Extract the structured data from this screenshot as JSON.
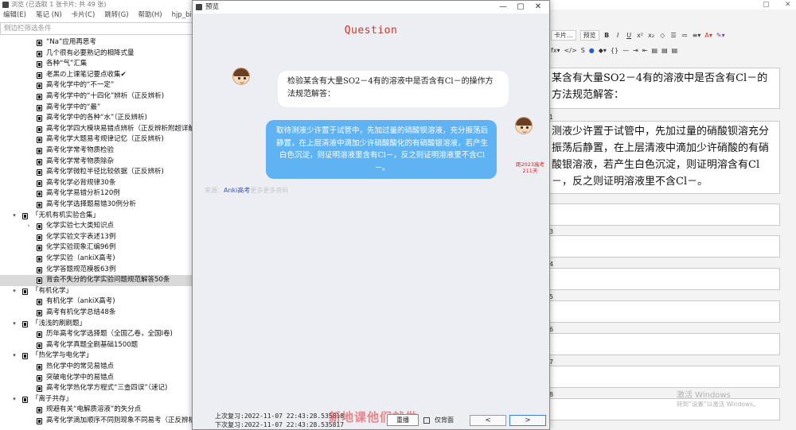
{
  "browser": {
    "title": "浏览 (已选取 1 张卡片; 共 49 张)",
    "menu": [
      "编辑(E)",
      "笔记 (N)",
      "卡片(C)",
      "跳转(G)",
      "帮助(H)",
      "hjp_bilink"
    ],
    "filter_placeholder": "侧边栏筛选条件"
  },
  "sidebar": {
    "rows": [
      {
        "label": "“Na”应用再思考",
        "level": 2,
        "type": "deck"
      },
      {
        "label": "几个很有必要熟记的相降式量",
        "level": 2,
        "type": "deck"
      },
      {
        "label": "各种“气”汇集",
        "level": 2,
        "type": "deck"
      },
      {
        "label": "老黑の上课笔记要点收集✔",
        "level": 2,
        "type": "deck"
      },
      {
        "label": "高考化学中的“不一定”",
        "level": 2,
        "type": "deck"
      },
      {
        "label": "高考化学中的“十四化”辨析（正反辨析)",
        "level": 2,
        "type": "deck"
      },
      {
        "label": "高考化学中的“最”",
        "level": 2,
        "type": "deck"
      },
      {
        "label": "高考化学中的各种“水”（正反辨析)",
        "level": 2,
        "type": "deck"
      },
      {
        "label": "高考化学四大模块易错点辨析（正反辨析附超详解析",
        "level": 2,
        "type": "deck"
      },
      {
        "label": "高考化学大题易考规律记忆（正反辨析)",
        "level": 2,
        "type": "deck"
      },
      {
        "label": "高考化学常考物质检验",
        "level": 2,
        "type": "deck"
      },
      {
        "label": "高考化学常考物质除杂",
        "level": 2,
        "type": "deck"
      },
      {
        "label": "高考化学微粒半径比较依据（正反辨析)",
        "level": 2,
        "type": "deck"
      },
      {
        "label": "高考化学必背规律30条",
        "level": 2,
        "type": "deck"
      },
      {
        "label": "高考化学易错分析120例",
        "level": 2,
        "type": "deck"
      },
      {
        "label": "高考化学选择题易错30例分析",
        "level": 2,
        "type": "deck"
      },
      {
        "label": "「无机有机实验合集」",
        "level": 1,
        "type": "group"
      },
      {
        "label": "化学实验七大类知识点",
        "level": 2,
        "type": "deck",
        "collapsed": true
      },
      {
        "label": "化学实验文字表述13例",
        "level": 2,
        "type": "deck"
      },
      {
        "label": "化学实验现象汇编96例",
        "level": 2,
        "type": "deck"
      },
      {
        "label": "化学实验（ankiX高考)",
        "level": 2,
        "type": "deck"
      },
      {
        "label": "化学答题规范模板63例",
        "level": 2,
        "type": "deck"
      },
      {
        "label": "背会不失分的化学实验问题规范解答50条",
        "level": 2,
        "type": "deck",
        "selected": true
      },
      {
        "label": "「有机化学」",
        "level": 1,
        "type": "group"
      },
      {
        "label": "有机化学（ankiX高考)",
        "level": 2,
        "type": "deck"
      },
      {
        "label": "高考有机化学总结48条",
        "level": 2,
        "type": "deck"
      },
      {
        "label": "「浅浅的刷刷题」",
        "level": 1,
        "type": "group"
      },
      {
        "label": "历年高考化学选择题（全国乙卷，全国I卷)",
        "level": 2,
        "type": "deck"
      },
      {
        "label": "高考化学真题全刷基础1500题",
        "level": 2,
        "type": "deck"
      },
      {
        "label": "「热化学与电化学」",
        "level": 1,
        "type": "group"
      },
      {
        "label": "热化学中的常见易错点",
        "level": 2,
        "type": "deck"
      },
      {
        "label": "突破电化学中的易错点",
        "level": 2,
        "type": "deck"
      },
      {
        "label": "高考化学热化学方程式“三查四误”（速记)",
        "level": 2,
        "type": "deck"
      },
      {
        "label": "「离子共存」",
        "level": 1,
        "type": "group"
      },
      {
        "label": "规避有关“电解质溶液”的失分点",
        "level": 2,
        "type": "deck"
      },
      {
        "label": "高考化学滴加顺序不同则现象不同易考（正反辨析)可复习",
        "level": 2,
        "type": "deck"
      }
    ]
  },
  "editor": {
    "toolbar_card": "卡片...",
    "toolbar_preview": "预览",
    "fields": [
      {
        "num": "",
        "text": "某含有大量SO2－4有的溶液中是否含有Cl－的方法规范解答："
      },
      {
        "num": "1",
        "text": "测液少许置于试管中，先加过量的硝酸钡溶充分振荡后静置，在上层清液中滴加少许硝酸的有硝酸银溶液，若产生白色沉淀，则证明溶含有Cl－，反之则证明溶液里不含Cl－。"
      },
      {
        "num": "",
        "text": ""
      },
      {
        "num": "3",
        "text": ""
      },
      {
        "num": "4",
        "text": ""
      },
      {
        "num": "5",
        "text": ""
      },
      {
        "num": "6",
        "text": ""
      },
      {
        "num": "7",
        "text": ""
      },
      {
        "num": "8",
        "text": ""
      }
    ],
    "watermark_line1": "激活 Windows",
    "watermark_line2": "转到“设置”以激活 Windows。"
  },
  "review": {
    "last": "上次复习:2022-11-07 22:43:28.535818",
    "next": "下次复习:2022-11-07 22:43:28.535817",
    "overlay": "新地课他们就做",
    "reply_btn": "重播",
    "back_only": "仅背面",
    "prev": "<",
    "next_btn": ">"
  },
  "dialog": {
    "title": "预览",
    "heading": "Question",
    "question": "检验某含有大量SO2－4有的溶液中是否含有Cl－的操作方法规范解答：",
    "answer": "取待测液少许置于试管中，先加过量的硝酸钡溶液，充分振荡后静置，在上层清液中滴加少许硝酸酸化的有硝酸银溶液，若产生白色沉淀，则证明溶液里含有Cl－，反之则证明溶液里不含Cl－。",
    "exam_tag_line1": "距2023高考",
    "exam_tag_line2": "211天",
    "source_pre": "来源：",
    "source_anki": "Anki高考",
    "source_post": "更多更多资料"
  },
  "colors": {
    "accent_red": "#c0392b",
    "bubble_blue": "#5fb3f2",
    "dialog_bg": "#edeef3"
  }
}
